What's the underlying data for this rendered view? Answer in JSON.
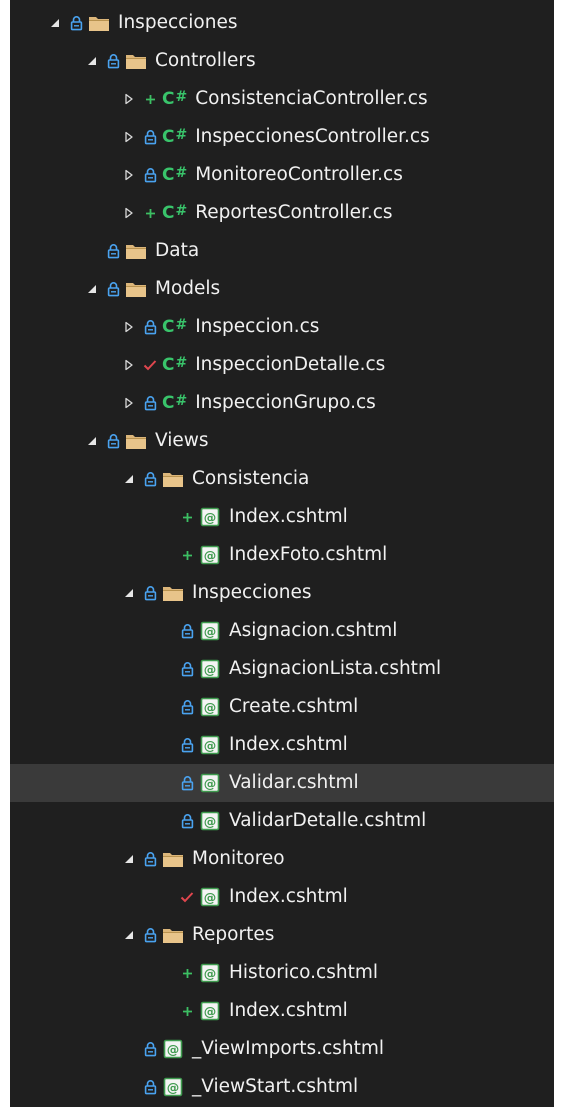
{
  "colors": {
    "background": "#1f1f1f",
    "selected_row": "#3a3a3a",
    "text": "#f1f1f1",
    "lock_status": "#4aa3f0",
    "added_status": "#3cbf63",
    "modified_status": "#e0464e",
    "folder": "#dcb67a",
    "csharp": "#39c46b",
    "razor": "#3e9a4e"
  },
  "csharp_icon_text": "C",
  "csharp_icon_hash": "#",
  "tree": [
    {
      "label": "Inspecciones",
      "depth": 0,
      "expander": "expanded",
      "status": "lock",
      "icon": "folder-icon"
    },
    {
      "label": "Controllers",
      "depth": 1,
      "expander": "expanded",
      "status": "lock",
      "icon": "folder-icon"
    },
    {
      "label": "ConsistenciaController.cs",
      "depth": 2,
      "expander": "collapsed",
      "status": "added",
      "icon": "csharp-icon"
    },
    {
      "label": "InspeccionesController.cs",
      "depth": 2,
      "expander": "collapsed",
      "status": "lock",
      "icon": "csharp-icon"
    },
    {
      "label": "MonitoreoController.cs",
      "depth": 2,
      "expander": "collapsed",
      "status": "lock",
      "icon": "csharp-icon"
    },
    {
      "label": "ReportesController.cs",
      "depth": 2,
      "expander": "collapsed",
      "status": "added",
      "icon": "csharp-icon"
    },
    {
      "label": "Data",
      "depth": 1,
      "expander": "none",
      "status": "lock",
      "icon": "folder-icon"
    },
    {
      "label": "Models",
      "depth": 1,
      "expander": "expanded",
      "status": "lock",
      "icon": "folder-icon"
    },
    {
      "label": "Inspeccion.cs",
      "depth": 2,
      "expander": "collapsed",
      "status": "lock",
      "icon": "csharp-icon"
    },
    {
      "label": "InspeccionDetalle.cs",
      "depth": 2,
      "expander": "collapsed",
      "status": "modified",
      "icon": "csharp-icon"
    },
    {
      "label": "InspeccionGrupo.cs",
      "depth": 2,
      "expander": "collapsed",
      "status": "lock",
      "icon": "csharp-icon"
    },
    {
      "label": "Views",
      "depth": 1,
      "expander": "expanded",
      "status": "lock",
      "icon": "folder-icon"
    },
    {
      "label": "Consistencia",
      "depth": 2,
      "expander": "expanded",
      "status": "lock",
      "icon": "folder-icon"
    },
    {
      "label": "Index.cshtml",
      "depth": 3,
      "expander": "none",
      "status": "added",
      "icon": "razor-icon"
    },
    {
      "label": "IndexFoto.cshtml",
      "depth": 3,
      "expander": "none",
      "status": "added",
      "icon": "razor-icon"
    },
    {
      "label": "Inspecciones",
      "depth": 2,
      "expander": "expanded",
      "status": "lock",
      "icon": "folder-icon"
    },
    {
      "label": "Asignacion.cshtml",
      "depth": 3,
      "expander": "none",
      "status": "lock",
      "icon": "razor-icon"
    },
    {
      "label": "AsignacionLista.cshtml",
      "depth": 3,
      "expander": "none",
      "status": "lock",
      "icon": "razor-icon"
    },
    {
      "label": "Create.cshtml",
      "depth": 3,
      "expander": "none",
      "status": "lock",
      "icon": "razor-icon"
    },
    {
      "label": "Index.cshtml",
      "depth": 3,
      "expander": "none",
      "status": "lock",
      "icon": "razor-icon"
    },
    {
      "label": "Validar.cshtml",
      "depth": 3,
      "expander": "none",
      "status": "lock",
      "icon": "razor-icon",
      "selected": true
    },
    {
      "label": "ValidarDetalle.cshtml",
      "depth": 3,
      "expander": "none",
      "status": "lock",
      "icon": "razor-icon"
    },
    {
      "label": "Monitoreo",
      "depth": 2,
      "expander": "expanded",
      "status": "lock",
      "icon": "folder-icon"
    },
    {
      "label": "Index.cshtml",
      "depth": 3,
      "expander": "none",
      "status": "modified",
      "icon": "razor-icon"
    },
    {
      "label": "Reportes",
      "depth": 2,
      "expander": "expanded",
      "status": "lock",
      "icon": "folder-icon"
    },
    {
      "label": "Historico.cshtml",
      "depth": 3,
      "expander": "none",
      "status": "added",
      "icon": "razor-icon"
    },
    {
      "label": "Index.cshtml",
      "depth": 3,
      "expander": "none",
      "status": "added",
      "icon": "razor-icon"
    },
    {
      "label": "_ViewImports.cshtml",
      "depth": 2,
      "expander": "none",
      "status": "lock",
      "icon": "razor-icon"
    },
    {
      "label": "_ViewStart.cshtml",
      "depth": 2,
      "expander": "none",
      "status": "lock",
      "icon": "razor-icon"
    }
  ]
}
